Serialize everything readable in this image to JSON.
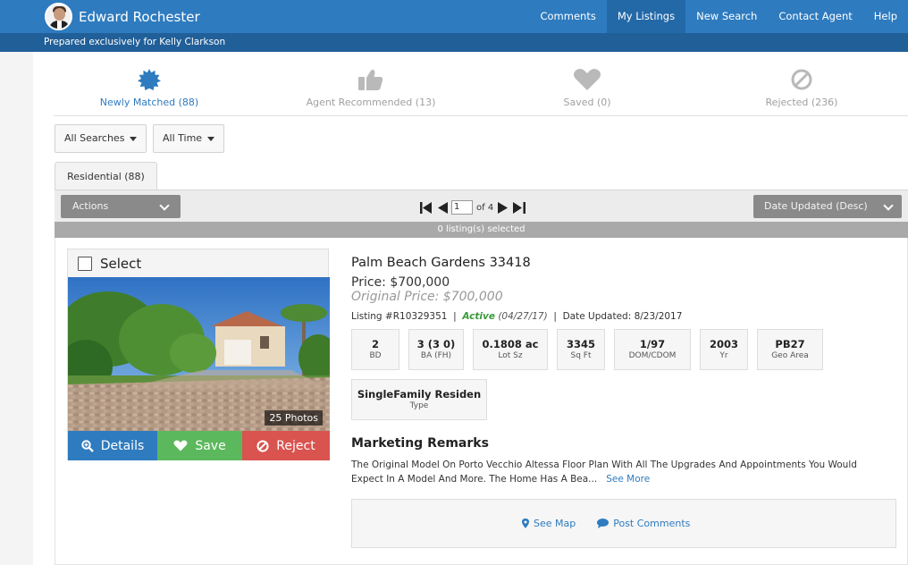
{
  "header": {
    "agent_name": "Edward Rochester",
    "nav": [
      "Comments",
      "My Listings",
      "New Search",
      "Contact Agent",
      "Help"
    ],
    "active_nav": "My Listings",
    "prepared_for": "Prepared exclusively for Kelly Clarkson",
    "brand_color": "#2e7bbf"
  },
  "categories": [
    {
      "label": "Newly Matched (88)",
      "icon": "badge-star-icon"
    },
    {
      "label": "Agent Recommended (13)",
      "icon": "thumbs-up-icon"
    },
    {
      "label": "Saved (0)",
      "icon": "heart-icon"
    },
    {
      "label": "Rejected (236)",
      "icon": "ban-icon"
    }
  ],
  "filters": {
    "searches": "All Searches",
    "time": "All Time"
  },
  "tab": "Residential (88)",
  "toolbar": {
    "actions": "Actions",
    "page": "1",
    "of_pages": "of 4",
    "sort": "Date Updated (Desc)"
  },
  "selected_text": "0 listing(s) selected",
  "listing": {
    "select_label": "Select",
    "photos": "25 Photos",
    "details_label": "Details",
    "save_label": "Save",
    "reject_label": "Reject",
    "address": "Palm Beach Gardens 33418",
    "price": "Price: $700,000",
    "original_price": "Original Price: $700,000",
    "listing_no": "Listing #R10329351",
    "status": "Active",
    "status_date": "(04/27/17)",
    "date_updated": "Date Updated: 8/23/2017",
    "facts": [
      {
        "value": "2",
        "label": "BD"
      },
      {
        "value": "3 (3 0)",
        "label": "BA (FH)"
      },
      {
        "value": "0.1808 ac",
        "label": "Lot Sz"
      },
      {
        "value": "3345",
        "label": "Sq Ft"
      },
      {
        "value": "1/97",
        "label": "DOM/CDOM"
      },
      {
        "value": "2003",
        "label": "Yr"
      },
      {
        "value": "PB27",
        "label": "Geo Area"
      },
      {
        "value": "SingleFamily Residen",
        "label": "Type"
      }
    ],
    "remarks_title": "Marketing Remarks",
    "remarks": "The Original Model On Porto Vecchio Altessa Floor Plan With All The Upgrades And Appointments You Would Expect In A Model And More. The Home Has A Bea...",
    "see_more": "See More",
    "see_map": "See Map",
    "post_comments": "Post Comments"
  }
}
